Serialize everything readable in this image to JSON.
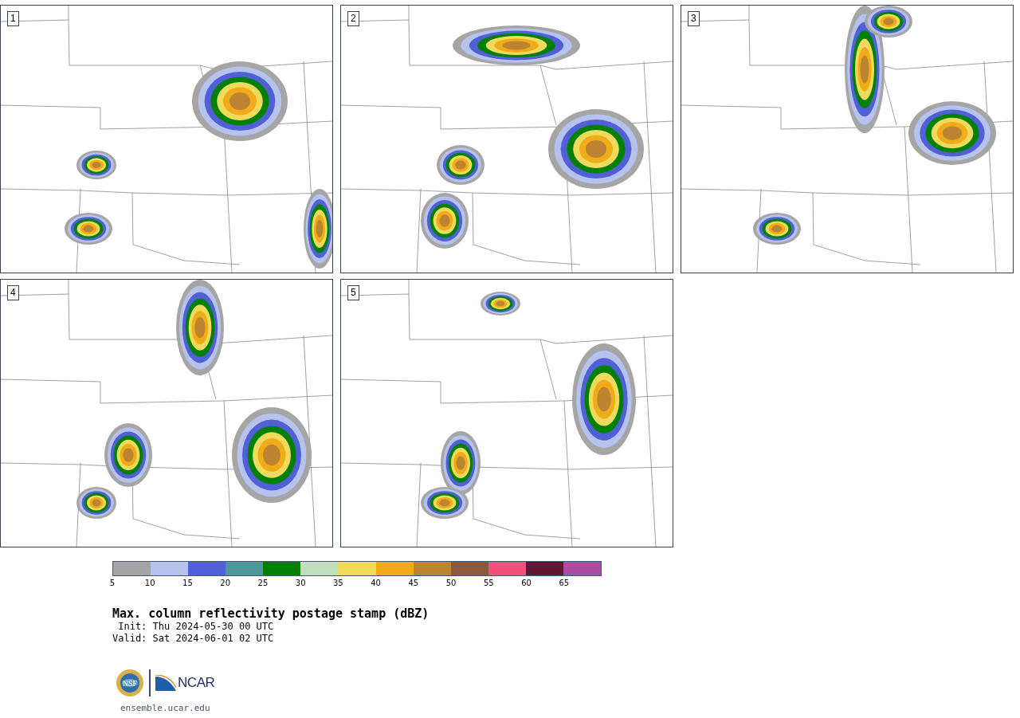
{
  "panels": [
    {
      "label": "1"
    },
    {
      "label": "2"
    },
    {
      "label": "3"
    },
    {
      "label": "4"
    },
    {
      "label": "5"
    }
  ],
  "colorbar": {
    "bins": [
      {
        "color": "#a5a5a5"
      },
      {
        "color": "#b6c2ee"
      },
      {
        "color": "#5260d6"
      },
      {
        "color": "#50979a"
      },
      {
        "color": "#008000"
      },
      {
        "color": "#bfdfbf"
      },
      {
        "color": "#f0da5c"
      },
      {
        "color": "#f0ac18"
      },
      {
        "color": "#bc8330"
      },
      {
        "color": "#8b5a3e"
      },
      {
        "color": "#f4507e"
      },
      {
        "color": "#611733"
      },
      {
        "color": "#ad4ba2"
      }
    ],
    "ticks": [
      "5",
      "10",
      "15",
      "20",
      "25",
      "30",
      "35",
      "40",
      "45",
      "50",
      "55",
      "60",
      "65"
    ]
  },
  "title": "Max. column reflectivity postage stamp (dBZ)",
  "init": " Init: Thu 2024-05-30 00 UTC",
  "valid": "Valid: Sat 2024-06-01 02 UTC",
  "seal_text": "NSF",
  "logo_text": "NCAR",
  "site": "ensemble.ucar.edu"
}
